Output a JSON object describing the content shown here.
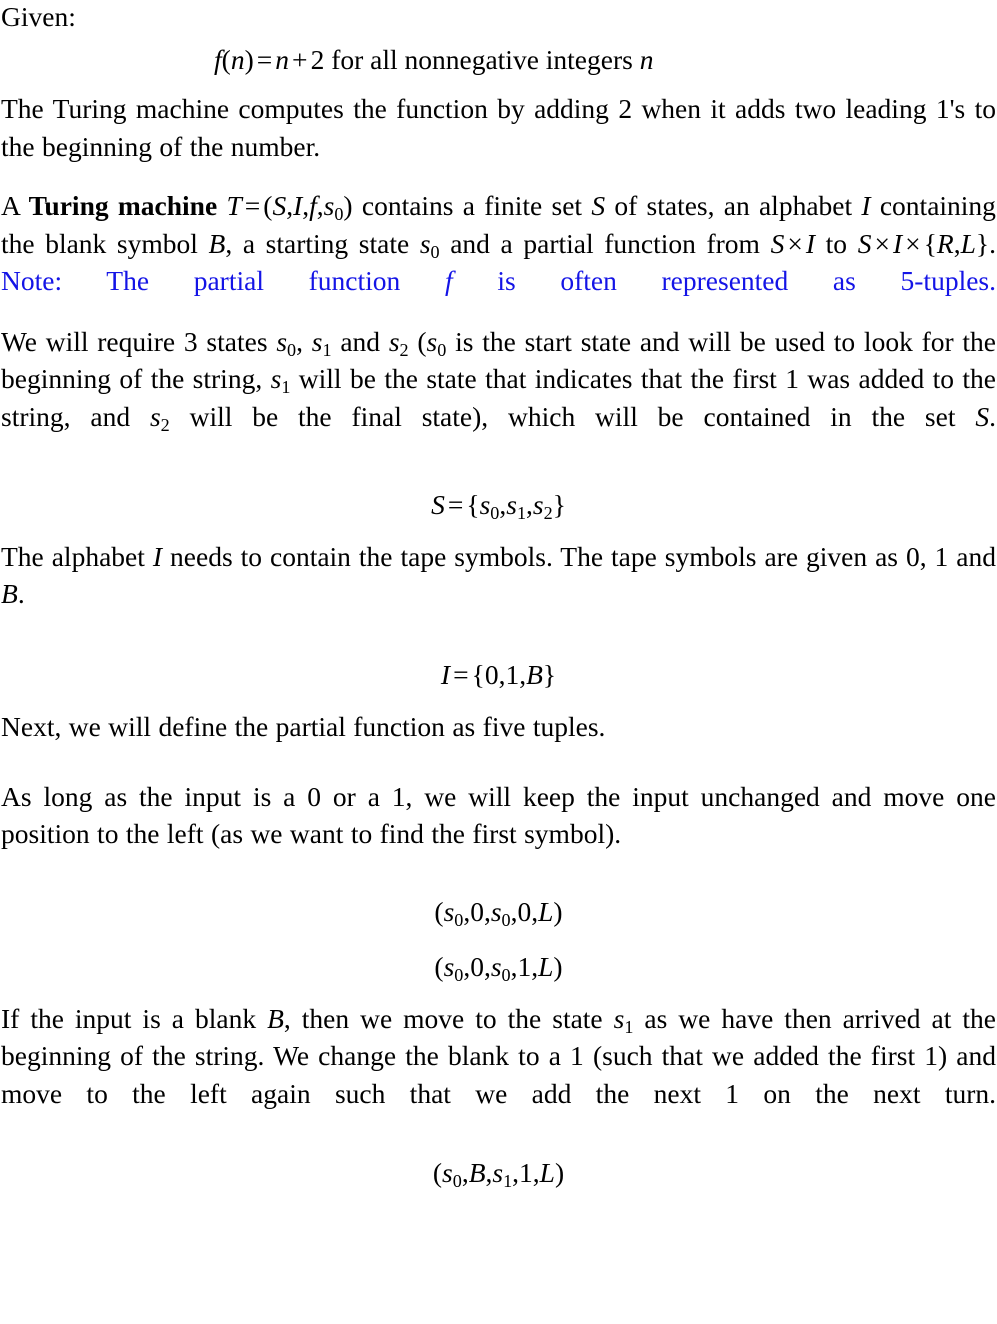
{
  "document": {
    "type": "math-solution",
    "topic": "Turing machine construction",
    "note_color": "#1414E6",
    "text_color": "#000000",
    "background_color": "#FFFFFF"
  },
  "blocks": {
    "given_label": "Given:",
    "eq_fn": {
      "lhs_f": "f",
      "lhs_open": "(",
      "lhs_n": "n",
      "lhs_close": ")",
      "eq": "=",
      "rhs_n": "n",
      "plus": "+",
      "rhs_2": "2",
      "tail": "for all nonnegative integers",
      "tail_n": "n"
    },
    "para_computes_1": "The Turing machine computes the function by adding 2 when it adds two",
    "para_computes_2": "leading 1's to the beginning of the number.",
    "para_def": {
      "a": "A",
      "bold_term": "Turing machine",
      "T": "T",
      "eq": "=",
      "open": "(",
      "S": "S",
      "c1": ",",
      "I": "I",
      "c2": ",",
      "f": "f",
      "c3": ",",
      "s": "s",
      "s_sub": "0",
      "close": ")",
      "t1": "contains a finite set",
      "S2": "S",
      "t2": "of states, an alphabet",
      "I2": "I",
      "t3": "containing the blank symbol",
      "B": "B",
      "t4": ", a starting state",
      "s0b": "s",
      "s0b_sub": "0",
      "t5": "and a partial function from",
      "S3": "S",
      "times1": "×",
      "I3": "I",
      "t6": "to",
      "S4": "S",
      "times2": "×",
      "I4": "I",
      "times3": "×",
      "brace_open": "{",
      "R": "R",
      "c4": ",",
      "L": "L",
      "brace_close": "}",
      "period": ".",
      "note_1": "Note: The partial function",
      "note_f": "f",
      "note_2": "is often represented as 5-tuples."
    },
    "para_states": {
      "t1": "We will require 3 states",
      "s0": "s",
      "s0_sub": "0",
      "c1": ",",
      "s1": "s",
      "s1_sub": "1",
      "t2": "and",
      "s2": "s",
      "s2_sub": "2",
      "paren": "(",
      "s0b": "s",
      "s0b_sub": "0",
      "t3": "is the start state and will be used to look for the beginning of the string,",
      "s1b": "s",
      "s1b_sub": "1",
      "t4": "will be the state that indicates that the first 1 was added to the string, and",
      "s2b": "s",
      "s2b_sub": "2",
      "t5": "will be the final state), which will be contained in the set",
      "S": "S",
      "period": "."
    },
    "eq_S": {
      "S": "S",
      "eq": "=",
      "open": "{",
      "s0": "s",
      "s0_sub": "0",
      "c1": ",",
      "s1": "s",
      "s1_sub": "1",
      "c2": ",",
      "s2": "s",
      "s2_sub": "2",
      "close": "}"
    },
    "para_alphabet": {
      "t1": "The alphabet",
      "I": "I",
      "t2": "needs to contain the tape symbols.  The tape symbols are given as 0, 1 and",
      "B": "B",
      "period": "."
    },
    "eq_I": {
      "I": "I",
      "eq": "=",
      "open": "{",
      "zero": "0",
      "c1": ",",
      "one": "1",
      "c2": ",",
      "B": "B",
      "close": "}"
    },
    "para_next": "Next, we will define the partial function as five tuples.",
    "para_aslong_1": "As long as the input is a 0 or a 1, we will keep the input unchanged and",
    "para_aslong_2": "move one position to the left (as we want to find the first symbol).",
    "tuple_1": {
      "open": "(",
      "s": "s",
      "s_sub": "0",
      "c1": ",",
      "read": "0",
      "c2": ",",
      "s_next": "s",
      "s_next_sub": "0",
      "c3": ",",
      "write": "0",
      "c4": ",",
      "move": "L",
      "close": ")"
    },
    "tuple_2": {
      "open": "(",
      "s": "s",
      "s_sub": "0",
      "c1": ",",
      "read": "0",
      "c2": ",",
      "s_next": "s",
      "s_next_sub": "0",
      "c3": ",",
      "write": "1",
      "c4": ",",
      "move": "L",
      "close": ")"
    },
    "para_blank": {
      "t1": "If the input is a blank",
      "B": "B",
      "t2": ", then we move to the state",
      "s1": "s",
      "s1_sub": "1",
      "t3": "as we have then arrived at the beginning of the string.  We change the blank to a 1 (such that we added the first 1) and move to the left again such that we add the next 1 on the next turn."
    },
    "tuple_3": {
      "open": "(",
      "s": "s",
      "s_sub": "0",
      "c1": ",",
      "read": "B",
      "c2": ",",
      "s_next": "s",
      "s_next_sub": "1",
      "c3": ",",
      "write": "1",
      "c4": ",",
      "move": "L",
      "close": ")"
    }
  }
}
